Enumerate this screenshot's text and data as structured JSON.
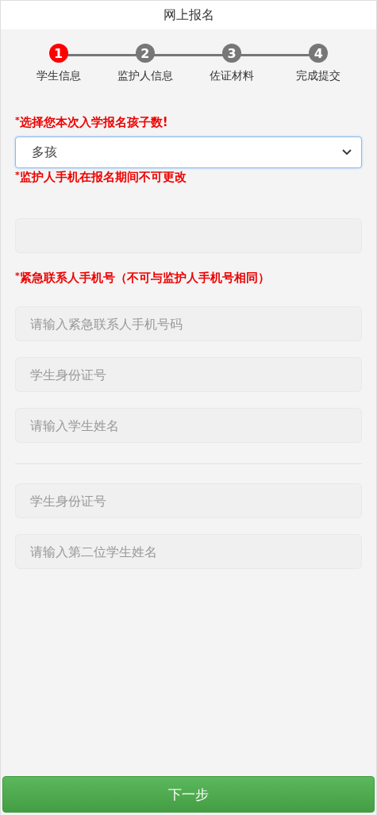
{
  "header": {
    "title": "网上报名"
  },
  "steps": [
    {
      "number": "1",
      "label": "学生信息",
      "selected": true
    },
    {
      "number": "2",
      "label": "监护人信息",
      "selected": false
    },
    {
      "number": "3",
      "label": "佐证材料",
      "selected": false
    },
    {
      "number": "4",
      "label": "完成提交",
      "selected": false
    }
  ],
  "child_count": {
    "mark": "*",
    "label": "选择您本次入学报名孩子数!",
    "value": "多孩"
  },
  "guardian_phone": {
    "mark": "*",
    "label": "监护人手机在报名期间不可更改"
  },
  "emergency_phone": {
    "mark": "*",
    "label": "紧急联系人手机号（不可与监护人手机号相同）",
    "placeholder": "请输入紧急联系人手机号码"
  },
  "students": [
    {
      "fields": [
        {
          "placeholder": "学生身份证号"
        },
        {
          "placeholder": "请输入学生姓名"
        }
      ]
    },
    {
      "fields": [
        {
          "placeholder": "学生身份证号"
        },
        {
          "placeholder": "请输入第二位学生姓名"
        }
      ]
    }
  ],
  "next_button": {
    "label": "下一步"
  }
}
